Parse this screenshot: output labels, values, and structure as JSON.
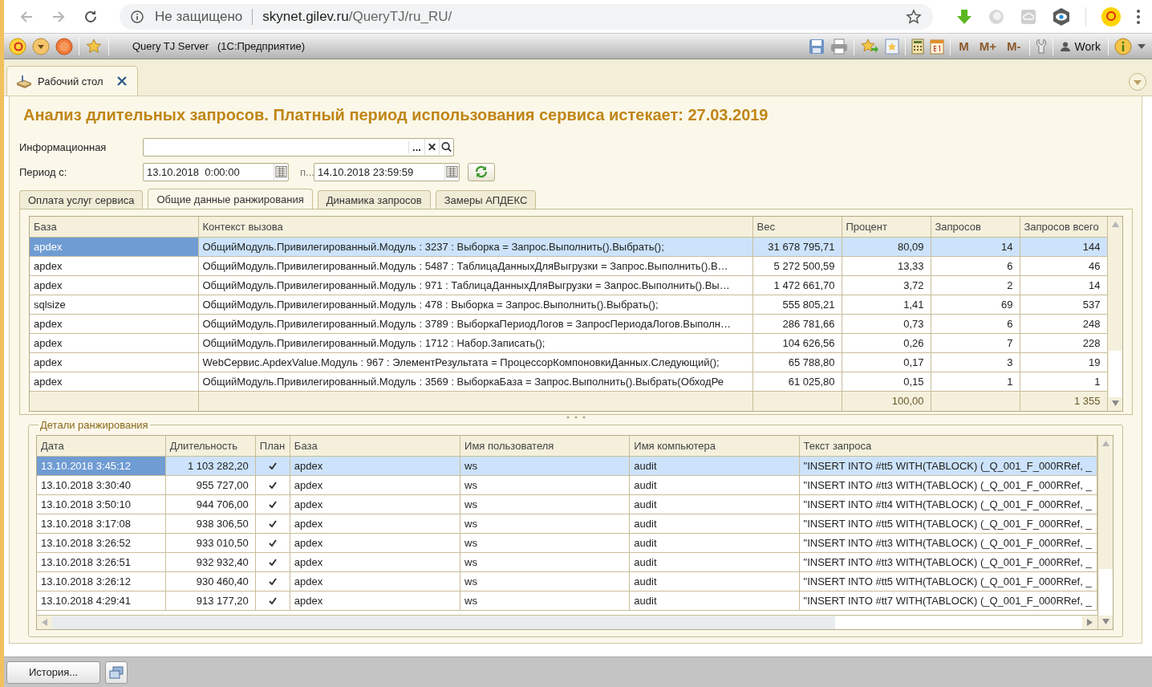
{
  "browser": {
    "security": "Не защищено",
    "url_host": "skynet.gilev.ru",
    "url_path": "/QueryTJ/ru_RU/"
  },
  "app_toolbar": {
    "title": "Query TJ Server   (1С:Предприятие)",
    "memory_buttons": [
      "M",
      "M+",
      "M-"
    ],
    "user": "Work"
  },
  "open_tabs": [
    {
      "label": "Рабочий стол",
      "selected": true
    }
  ],
  "page_title": "Анализ длительных запросов. Платный период использования сервиса истекает: 27.03.2019",
  "filters": {
    "infobase_label": "Информационная",
    "choose_button": "...",
    "period_label": "Период с:",
    "period_from": "13.10.2018  0:00:00",
    "period_to_label": "п...",
    "period_to": "14.10.2018 23:59:59"
  },
  "tabs": [
    {
      "label": "Оплата услуг сервиса",
      "selected": false
    },
    {
      "label": "Общие данные ранжирования",
      "selected": true
    },
    {
      "label": "Динамика запросов",
      "selected": false
    },
    {
      "label": "Замеры АПДЕКС",
      "selected": false
    }
  ],
  "ranking_table": {
    "columns": [
      "База",
      "Контекст вызова",
      "Вес",
      "Процент",
      "Запросов",
      "Запросов всего"
    ],
    "rows": [
      {
        "cells": [
          "apdex",
          "ОбщийМодуль.Привилегированный.Модуль : 3237 : Выборка = Запрос.Выполнить().Выбрать();",
          "31 678 795,71",
          "80,09",
          "14",
          "144"
        ],
        "selected": true
      },
      {
        "cells": [
          "apdex",
          "ОбщийМодуль.Привилегированный.Модуль : 5487 : ТаблицаДанныхДляВыгрузки = Запрос.Выполнить().В…",
          "5 272 500,59",
          "13,33",
          "6",
          "46"
        ],
        "selected": false
      },
      {
        "cells": [
          "apdex",
          "ОбщийМодуль.Привилегированный.Модуль : 971 : ТаблицаДанныхДляВыгрузки = Запрос.Выполнить().Вы…",
          "1 472 661,70",
          "3,72",
          "2",
          "14"
        ],
        "selected": false
      },
      {
        "cells": [
          "sqlsize",
          "ОбщийМодуль.Привилегированный.Модуль : 478 : Выборка = Запрос.Выполнить().Выбрать();",
          "555 805,21",
          "1,41",
          "69",
          "537"
        ],
        "selected": false
      },
      {
        "cells": [
          "apdex",
          "ОбщийМодуль.Привилегированный.Модуль : 3789 : ВыборкаПериодЛогов = ЗапросПериодаЛогов.Выполн…",
          "286 781,66",
          "0,73",
          "6",
          "248"
        ],
        "selected": false
      },
      {
        "cells": [
          "apdex",
          "ОбщийМодуль.Привилегированный.Модуль : 1712 : Набор.Записать();",
          "104 626,56",
          "0,26",
          "7",
          "228"
        ],
        "selected": false
      },
      {
        "cells": [
          "apdex",
          "WebСервис.ApdexValue.Модуль : 967 : ЭлементРезультата = ПроцессорКомпоновкиДанных.Следующий();",
          "65 788,80",
          "0,17",
          "3",
          "19"
        ],
        "selected": false
      },
      {
        "cells": [
          "apdex",
          "ОбщийМодуль.Привилегированный.Модуль : 3569 : ВыборкаБаза = Запрос.Выполнить().Выбрать(ОбходРе",
          "61 025,80",
          "0,15",
          "1",
          "1"
        ],
        "selected": false
      }
    ],
    "totals": {
      "percent": "100,00",
      "requests_total": "1 355"
    }
  },
  "details": {
    "title": "Детали ранжирования",
    "columns": [
      "Дата",
      "Длительность",
      "План",
      "База",
      "Имя пользователя",
      "Имя компьютера",
      "Текст запроса"
    ],
    "rows": [
      {
        "date": "13.10.2018 3:45:12",
        "duration": "1 103 282,20",
        "plan": true,
        "base": "apdex",
        "user": "ws",
        "computer": "audit",
        "query": "\"INSERT INTO #tt5 WITH(TABLOCK) (_Q_001_F_000RRef, _",
        "selected": true
      },
      {
        "date": "13.10.2018 3:30:40",
        "duration": "955 727,00",
        "plan": true,
        "base": "apdex",
        "user": "ws",
        "computer": "audit",
        "query": "\"INSERT INTO #tt3 WITH(TABLOCK) (_Q_001_F_000RRef, _",
        "selected": false
      },
      {
        "date": "13.10.2018 3:50:10",
        "duration": "944 706,00",
        "plan": true,
        "base": "apdex",
        "user": "ws",
        "computer": "audit",
        "query": "\"INSERT INTO #tt4 WITH(TABLOCK) (_Q_001_F_000RRef, _",
        "selected": false
      },
      {
        "date": "13.10.2018 3:17:08",
        "duration": "938 306,50",
        "plan": true,
        "base": "apdex",
        "user": "ws",
        "computer": "audit",
        "query": "\"INSERT INTO #tt5 WITH(TABLOCK) (_Q_001_F_000RRef, _",
        "selected": false
      },
      {
        "date": "13.10.2018 3:26:52",
        "duration": "933 010,50",
        "plan": true,
        "base": "apdex",
        "user": "ws",
        "computer": "audit",
        "query": "\"INSERT INTO #tt3 WITH(TABLOCK) (_Q_001_F_000RRef, _",
        "selected": false
      },
      {
        "date": "13.10.2018 3:26:51",
        "duration": "932 932,40",
        "plan": true,
        "base": "apdex",
        "user": "ws",
        "computer": "audit",
        "query": "\"INSERT INTO #tt3 WITH(TABLOCK) (_Q_001_F_000RRef, _",
        "selected": false
      },
      {
        "date": "13.10.2018 3:26:12",
        "duration": "930 460,40",
        "plan": true,
        "base": "apdex",
        "user": "ws",
        "computer": "audit",
        "query": "\"INSERT INTO #tt5 WITH(TABLOCK) (_Q_001_F_000RRef, _",
        "selected": false
      },
      {
        "date": "13.10.2018 4:29:41",
        "duration": "913 177,20",
        "plan": true,
        "base": "apdex",
        "user": "ws",
        "computer": "audit",
        "query": "\"INSERT INTO #tt7 WITH(TABLOCK) (_Q_001_F_000RRef, _",
        "selected": false
      }
    ]
  },
  "bottom_bar": {
    "history_button": "История..."
  }
}
